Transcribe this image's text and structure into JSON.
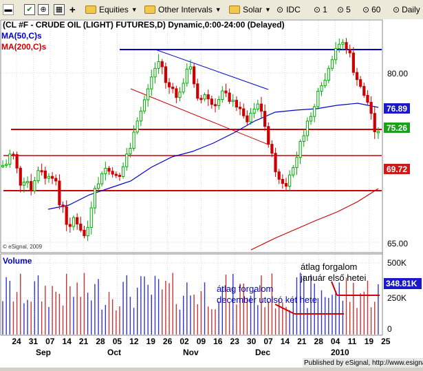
{
  "toolbar": {
    "equities_label": "Equities",
    "intervals_label": "Other Intervals",
    "solar_label": "Solar",
    "idc_label": "IDC",
    "n1": "1",
    "n5": "5",
    "n60": "60",
    "daily": "Daily"
  },
  "chart": {
    "title": "(CL #F - CRUDE OIL (LIGHT) FUTURES,D) Dynamic,0:00-24:00 (Delayed)",
    "ma50": "MA(50,C)s",
    "ma200": "MA(200,C)s",
    "copyright": "© eSignal, 2009",
    "volume_label": "Volume",
    "published": "Published by eSignal, http://www.esignal.com",
    "annotation_dec": [
      "átlag forgalom",
      "december utolsó két hete"
    ],
    "annotation_jan": [
      "átlag forgalom",
      "január első hetei"
    ]
  },
  "colors": {
    "blue_ma": "#0000cc",
    "red_ma": "#cc0000",
    "up": "#00aa00",
    "down": "#cc0000"
  },
  "chart_data": {
    "type": "candlestick",
    "price_axis": {
      "ticks": [
        "80.00",
        "65.00"
      ]
    },
    "price_tags": [
      "76.89",
      "75.26",
      "69.72"
    ],
    "volume_axis": {
      "ticks": [
        "500K",
        "250K",
        "0"
      ]
    },
    "volume_tag": "348.81K",
    "date_ticks": [
      "24",
      "31",
      "07",
      "14",
      "21",
      "28",
      "05",
      "12",
      "19",
      "26",
      "02",
      "09",
      "16",
      "23",
      "30",
      "07",
      "14",
      "21",
      "28",
      "04",
      "11",
      "19",
      "25"
    ],
    "months": [
      "Sep",
      "Oct",
      "Nov",
      "Dec",
      "2010"
    ]
  }
}
